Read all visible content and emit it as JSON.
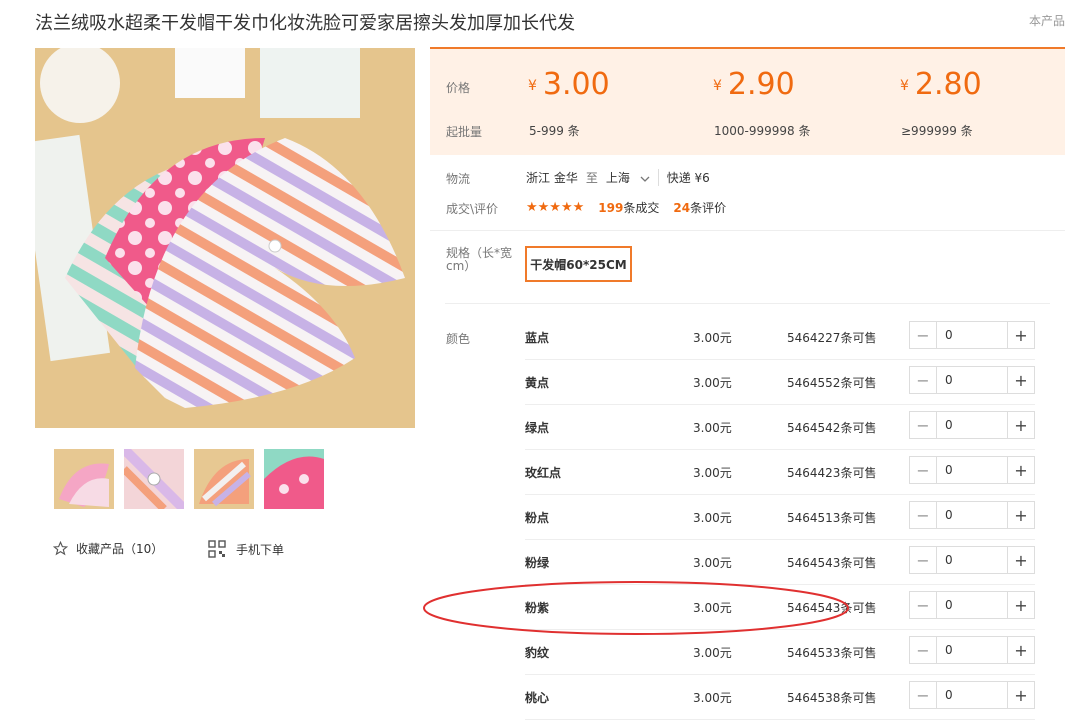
{
  "product": {
    "title": "法兰绒吸水超柔干发帽干发巾化妆洗脸可爱家居擦头发加厚加长代发",
    "top_right": "本产品"
  },
  "price_panel": {
    "price_label": "价格",
    "batch_label": "起批量",
    "currency": "¥",
    "tiers": [
      {
        "price": "3.00",
        "range": "5-999 条"
      },
      {
        "price": "2.90",
        "range": "1000-999998 条"
      },
      {
        "price": "2.80",
        "range": "≥999999 条"
      }
    ],
    "accent_color": "#f06a10"
  },
  "logistics": {
    "label": "物流",
    "from": "浙江 金华",
    "to_word": "至",
    "to": "上海",
    "express": "快递 ¥6"
  },
  "deals": {
    "label": "成交\\评价",
    "stars": "★★★★★",
    "deals_count": "199",
    "deals_text": "条成交",
    "reviews_count": "24",
    "reviews_text": "条评价"
  },
  "spec": {
    "label": "规格（长*宽cm）",
    "selected": "干发帽60*25CM"
  },
  "colors": {
    "label": "颜色",
    "items": [
      {
        "name": "蓝点",
        "price": "3.00元",
        "stock": "5464227条可售",
        "qty": "0"
      },
      {
        "name": "黄点",
        "price": "3.00元",
        "stock": "5464552条可售",
        "qty": "0"
      },
      {
        "name": "绿点",
        "price": "3.00元",
        "stock": "5464542条可售",
        "qty": "0"
      },
      {
        "name": "玫红点",
        "price": "3.00元",
        "stock": "5464423条可售",
        "qty": "0"
      },
      {
        "name": "粉点",
        "price": "3.00元",
        "stock": "5464513条可售",
        "qty": "0"
      },
      {
        "name": "粉绿",
        "price": "3.00元",
        "stock": "5464543条可售",
        "qty": "0"
      },
      {
        "name": "粉紫",
        "price": "3.00元",
        "stock": "5464543条可售",
        "qty": "0"
      },
      {
        "name": "豹纹",
        "price": "3.00元",
        "stock": "5464533条可售",
        "qty": "0"
      },
      {
        "name": "桃心",
        "price": "3.00元",
        "stock": "5464538条可售",
        "qty": "0"
      }
    ]
  },
  "actions": {
    "favorite": "收藏产品（10）",
    "mobile_order": "手机下单"
  },
  "stepper_symbols": {
    "minus": "−",
    "plus": "+"
  }
}
